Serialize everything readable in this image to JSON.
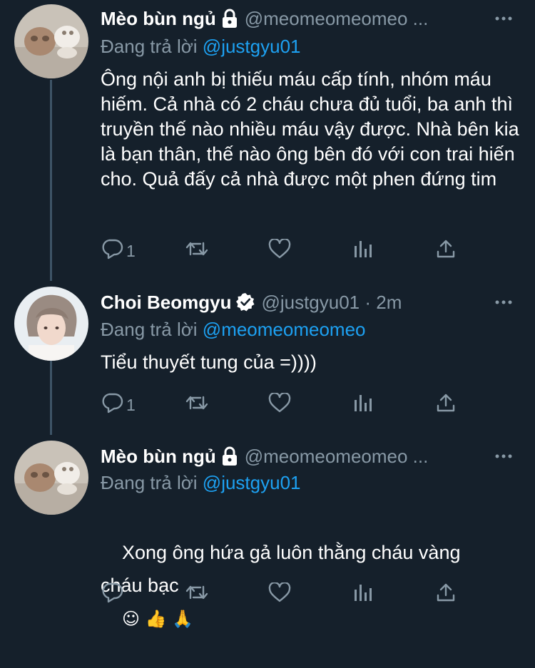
{
  "colors": {
    "background": "#15202b",
    "text": "#ffffff",
    "secondary": "#8899a6",
    "accent": "#1da1f2",
    "thread_line": "#3d5466"
  },
  "tweets": [
    {
      "name": "Mèo bùn ngủ",
      "badge": "lock-icon",
      "handle": "@meomeomeomeo ...",
      "replying_prefix": "Đang trả lời",
      "replying_to": "@justgyu01",
      "text": "Ông nội anh bị thiếu máu cấp tính, nhóm máu hiếm. Cả nhà có 2 cháu chưa đủ tuổi, ba anh thì truyền thế nào nhiều máu vậy được. Nhà bên kia là bạn thân, thế nào ông bên đó với con trai hiến cho. Quả đấy cả nhà được một phen đứng tim",
      "reply_count": "1"
    },
    {
      "name": "Choi Beomgyu",
      "badge": "verified-icon",
      "handle": "@justgyu01 · 2m",
      "replying_prefix": "Đang trả lời",
      "replying_to": "@meomeomeomeo",
      "text": "Tiểu thuyết tung của =))))",
      "reply_count": "1"
    },
    {
      "name": "Mèo bùn ngủ",
      "badge": "lock-icon",
      "handle": "@meomeomeomeo ...",
      "replying_prefix": "Đang trả lời",
      "replying_to": "@justgyu01",
      "text": "Xong ông hứa gả luôn thằng cháu vàng cháu bạc",
      "emojis": "☺ 👍 🙏",
      "reply_count": ""
    }
  ]
}
